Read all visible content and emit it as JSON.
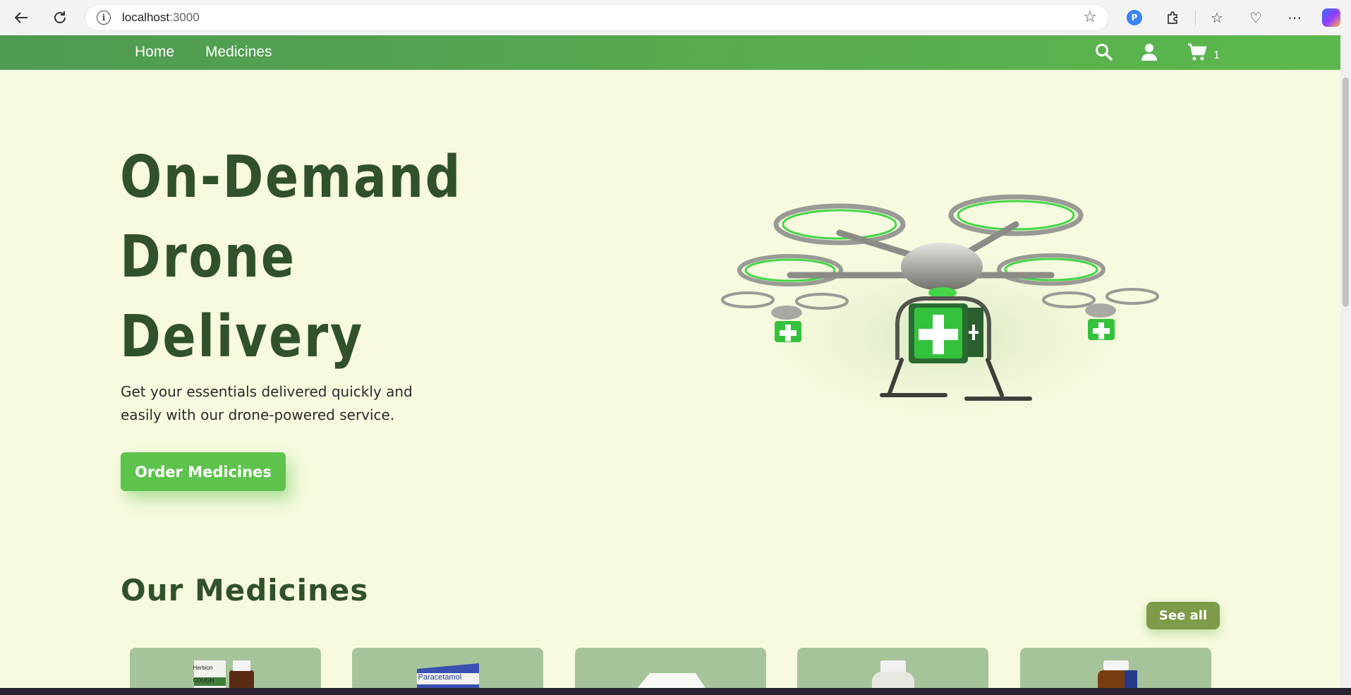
{
  "browser": {
    "url_host": "localhost",
    "url_port": ":3000",
    "back_icon": "back-arrow-icon",
    "refresh_icon": "refresh-icon"
  },
  "nav": {
    "links": [
      "Home",
      "Medicines"
    ],
    "cart_count": "1"
  },
  "hero": {
    "title_lines": [
      "On-Demand",
      "Drone",
      "Delivery"
    ],
    "subtitle": "Get your essentials delivered quickly and easily with our drone-powered service.",
    "cta": "Order Medicines"
  },
  "medicines": {
    "title": "Our Medicines",
    "see_all": "See all",
    "cards": [
      {
        "label": "Herbion COUGH"
      },
      {
        "label": "Paracetamol"
      },
      {
        "label": ""
      },
      {
        "label": ""
      },
      {
        "label": ""
      }
    ]
  },
  "colors": {
    "nav_green": "#5cb84c",
    "hero_bg": "#f7fadf",
    "title_green": "#30512a",
    "cta_green": "#5ec34d",
    "see_all_olive": "#7d9b48",
    "card_bg": "#a6c49a"
  }
}
